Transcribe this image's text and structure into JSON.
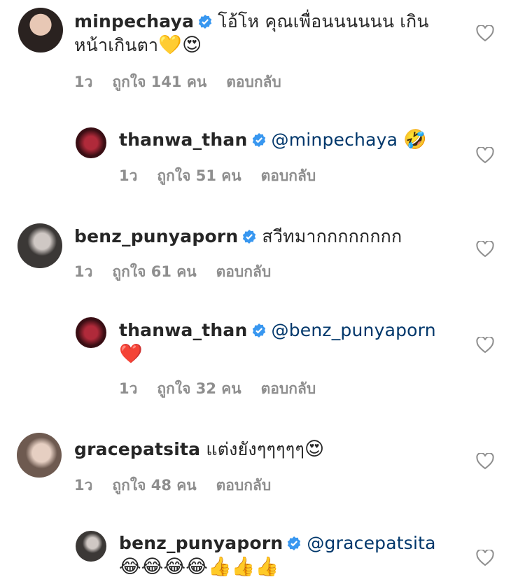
{
  "comments": [
    {
      "username": "minpechaya",
      "verified": true,
      "text_line1": "โอ้โห คุณเพื่อนนนนนน เกิน",
      "text_line2": "หน้าเกินตา",
      "emojis": "💛😍",
      "time": "1ว",
      "likes": "ถูกใจ 141 คน",
      "reply": "ตอบกลับ"
    },
    {
      "username": "thanwa_than",
      "verified": true,
      "mention": "@minpechaya",
      "emojis": "🤣",
      "time": "1ว",
      "likes": "ถูกใจ 51 คน",
      "reply": "ตอบกลับ"
    },
    {
      "username": "benz_punyaporn",
      "verified": true,
      "text": "สวีทมากกกกกกกก",
      "time": "1ว",
      "likes": "ถูกใจ 61 คน",
      "reply": "ตอบกลับ"
    },
    {
      "username": "thanwa_than",
      "verified": true,
      "mention": "@benz_punyaporn",
      "emojis": "❤️",
      "time": "1ว",
      "likes": "ถูกใจ 32 คน",
      "reply": "ตอบกลับ"
    },
    {
      "username": "gracepatsita",
      "verified": false,
      "text": "แต่งยังๆๆๆๆๆ",
      "emojis": "😍",
      "time": "1ว",
      "likes": "ถูกใจ 48 คน",
      "reply": "ตอบกลับ"
    },
    {
      "username": "benz_punyaporn",
      "verified": true,
      "mention": "@gracepatsita",
      "emojis": "😂😂😂😂👍👍👍"
    }
  ],
  "colors": {
    "verified": "#3897f0",
    "mention": "#00376b",
    "meta": "#8e8e8e",
    "heart_outline": "#8e8e8e"
  }
}
